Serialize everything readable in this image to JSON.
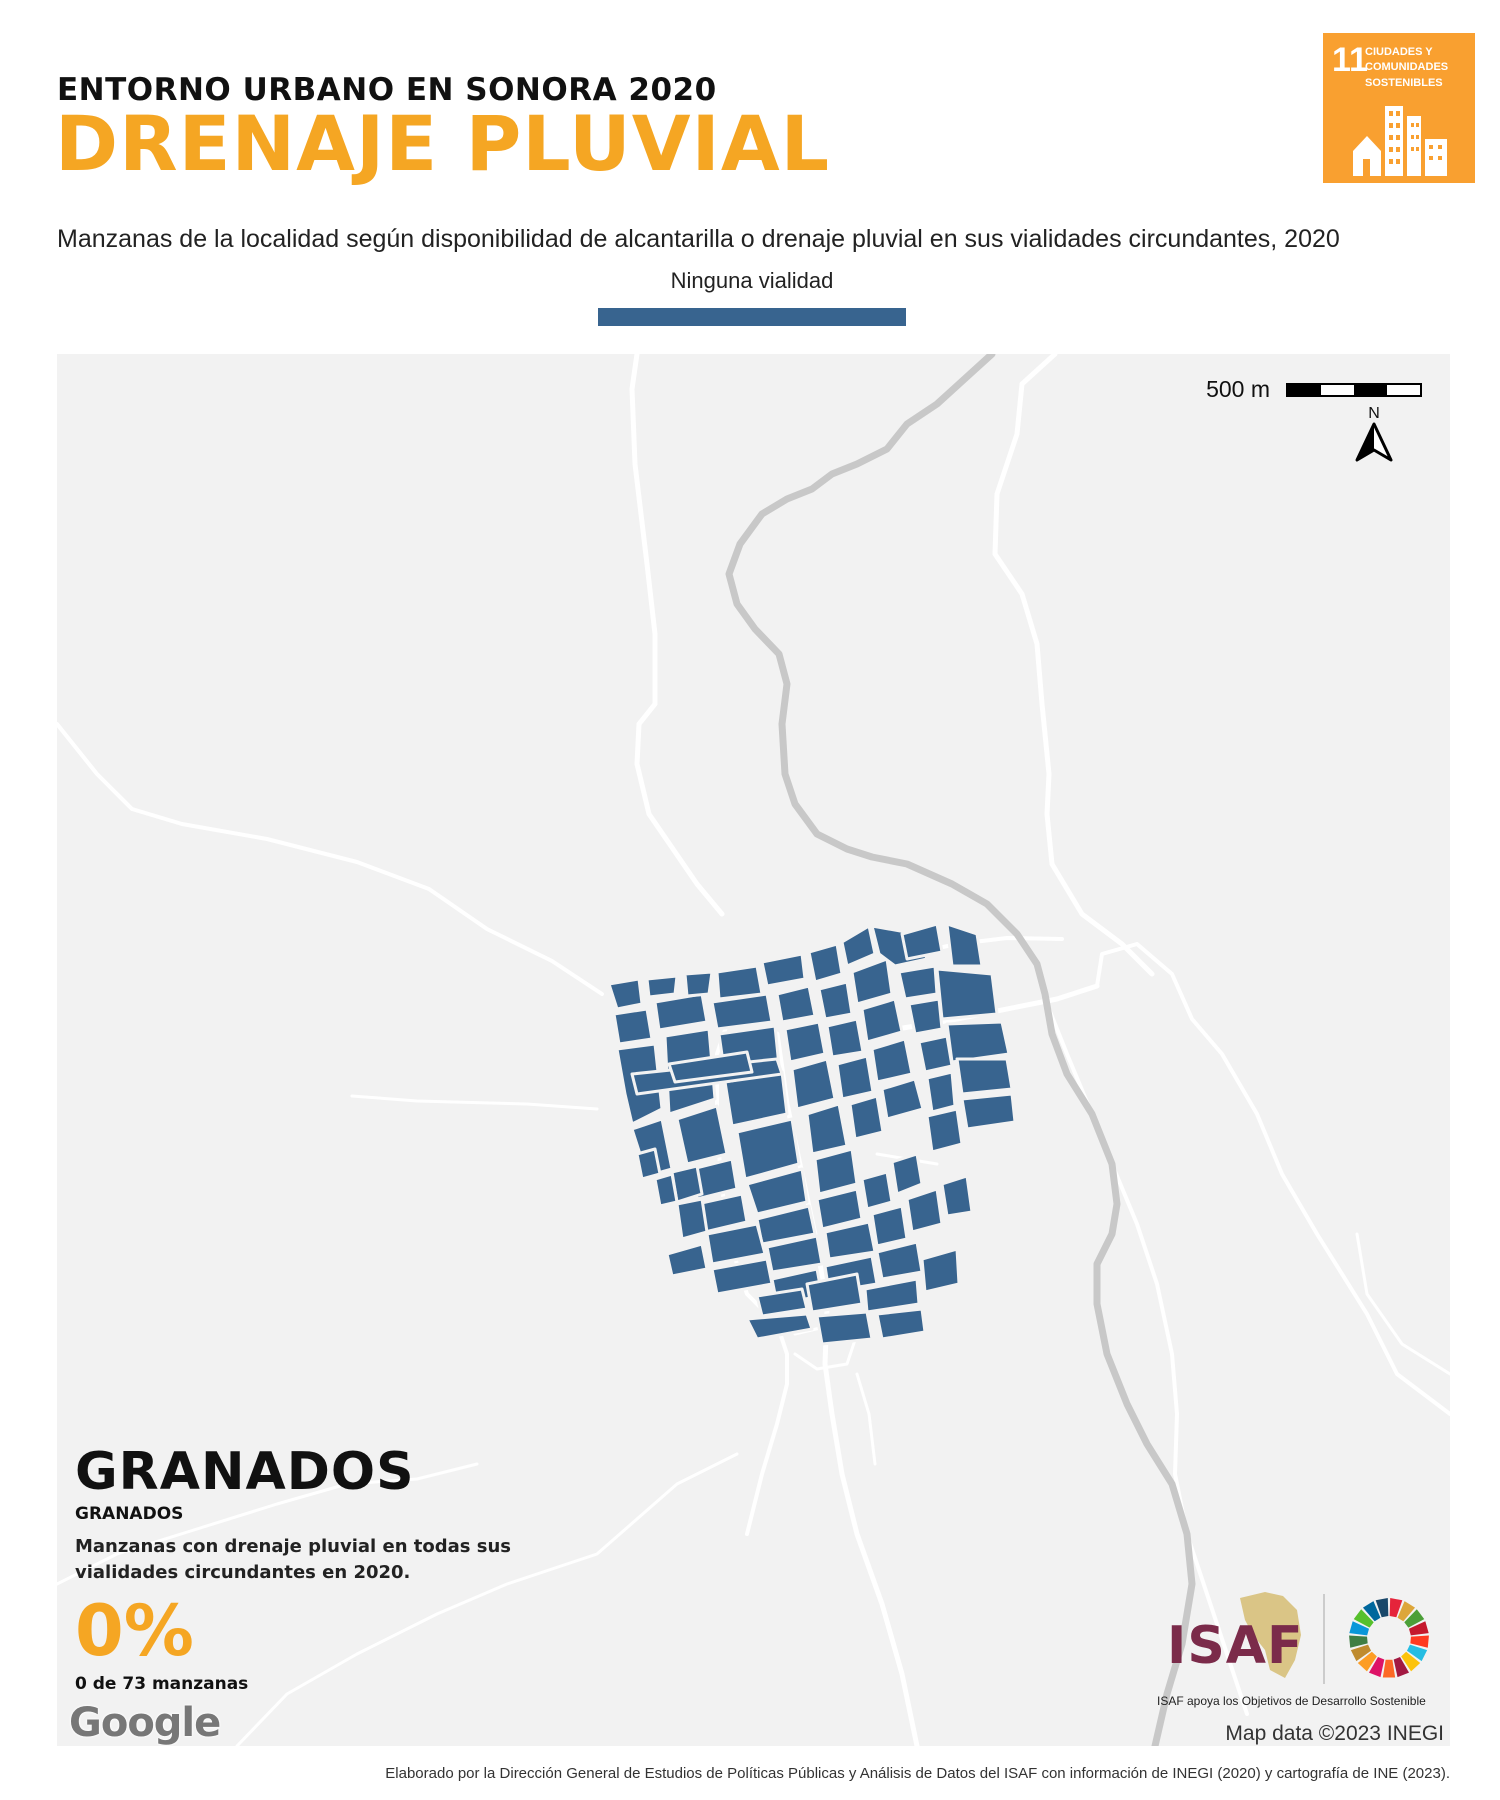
{
  "header": {
    "pretitle": "ENTORNO URBANO EN SONORA 2020",
    "title": "DRENAJE PLUVIAL",
    "subtitle": "Manzanas de la localidad según disponibilidad de alcantarilla o drenaje pluvial en sus vialidades circundantes, 2020"
  },
  "legend": {
    "label": "Ninguna vialidad",
    "color": "#38648f"
  },
  "sdg_badge": {
    "number": "11",
    "text": "CIUDADES Y\nCOMUNIDADES\nSOSTENIBLES",
    "color": "#f9a030"
  },
  "map": {
    "scale_label": "500 m",
    "north_label": "N",
    "background": "#f2f2f2",
    "block_color": "#38648f",
    "river_color": "#c8c8c8"
  },
  "info": {
    "place_name": "GRANADOS",
    "place_sub": "GRANADOS",
    "description": "Manzanas con drenaje pluvial en todas sus vialidades circundantes en 2020.",
    "percentage": "0%",
    "count_text": "0 de 73 manzanas"
  },
  "branding": {
    "google": "Google",
    "map_attribution": "Map data ©2023 INEGI",
    "isaf_logo": "ISAF",
    "isaf_caption": "ISAF apoya los Objetivos de Desarrollo Sostenible"
  },
  "footer": "Elaborado por la Dirección General de Estudios de Políticas Públicas y Análisis de Datos del ISAF con información de INEGI (2020) y cartografía de INE (2023)."
}
